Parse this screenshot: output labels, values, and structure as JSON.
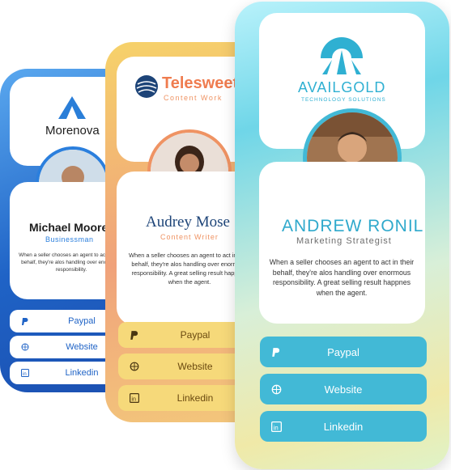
{
  "cards": [
    {
      "logo_text": "Morenova",
      "name": "Michael Moore",
      "role": "Businessman",
      "desc": "When a seller chooses an agent to act in their behalf, they're alos handling over enormous responsibility.",
      "links": [
        "Paypal",
        "Website",
        "Linkedin"
      ]
    },
    {
      "logo_text": "Telesweet",
      "logo_sub": "Content Work",
      "name": "Audrey Mose",
      "role": "Content Writer",
      "desc": "When a seller chooses an agent to act in their behalf, they're alos handling over enormous responsibility. A great selling result happnes when the agent.",
      "links": [
        "Paypal",
        "Website",
        "Linkedin"
      ]
    },
    {
      "logo_text": "AVAILGOLD",
      "logo_sub": "TECHNOLOGY SOLUTIONS",
      "name": "ANDREW RONIL",
      "role": "Marketing Strategist",
      "desc": "When a seller chooses an agent to act in their behalf, they're alos handling over enormous responsibility. A great selling result happnes when the agent.",
      "links": [
        "Paypal",
        "Website",
        "Linkedin"
      ]
    }
  ],
  "icons": {
    "paypal": "paypal-icon",
    "website": "globe-icon",
    "linkedin": "linkedin-icon"
  },
  "colors": {
    "blue": "#1f63c6",
    "orange": "#ef9363",
    "teal": "#42b9d6",
    "navy": "#1d4478"
  }
}
